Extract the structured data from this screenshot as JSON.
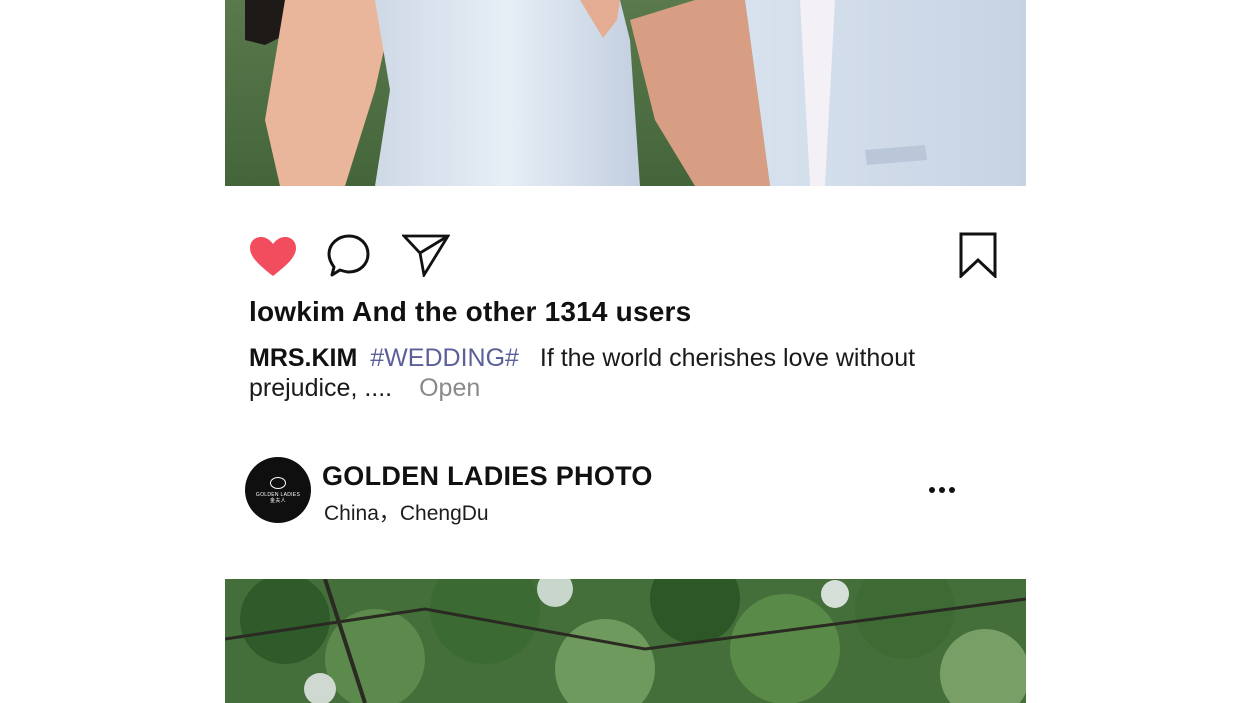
{
  "post": {
    "likes_text": "lowkim And the other 1314 users",
    "caption": {
      "username": "MRS.KIM",
      "hashtag": "#WEDDING#",
      "text": "If the world cherishes love without prejudice, ....",
      "open_label": "Open"
    },
    "icons": {
      "like": "heart-icon",
      "comment": "comment-icon",
      "share": "send-icon",
      "save": "bookmark-icon",
      "more": "more-icon"
    },
    "like_color": "#f24d5e"
  },
  "next_post": {
    "account_name": "GOLDEN LADIES PHOTO",
    "location": "China，ChengDu",
    "avatar": {
      "logo_text": "GOLDEN LADIES",
      "logo_subtext": "金夫人"
    }
  }
}
